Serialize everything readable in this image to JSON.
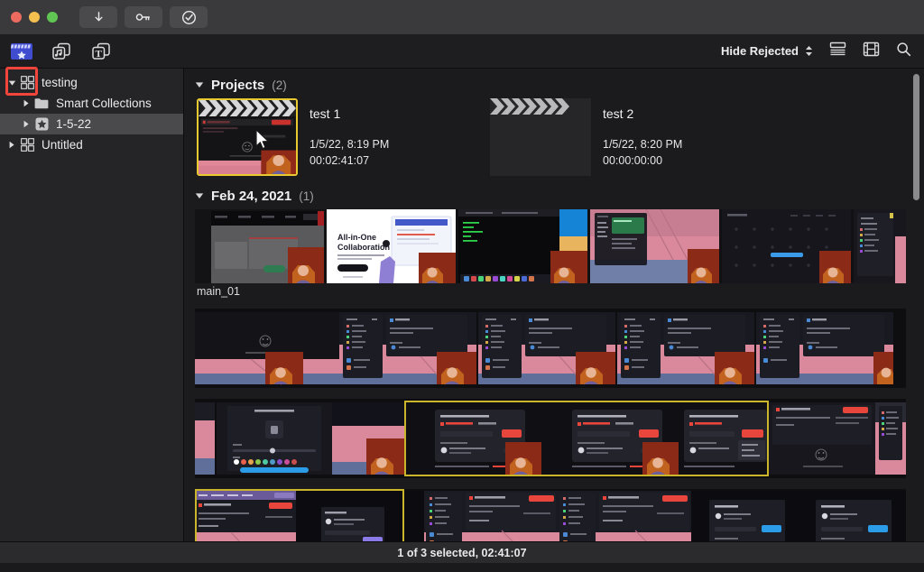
{
  "window": {
    "traffic_lights": [
      "close",
      "minimize",
      "zoom"
    ],
    "toolbar_buttons": [
      {
        "name": "import-media-button",
        "icon": "download-arrow-icon"
      },
      {
        "name": "keyword-editor-button",
        "icon": "key-icon"
      },
      {
        "name": "share-button",
        "icon": "check-circle-icon"
      }
    ]
  },
  "browser_toolbar": {
    "tabs": [
      {
        "name": "photos-and-audio-browser",
        "icon": "clapperboard-icon",
        "active": true
      },
      {
        "name": "music-browser",
        "icon": "music-notes-icon",
        "active": false
      },
      {
        "name": "titles-and-generators-browser",
        "icon": "titles-t-icon",
        "active": false
      }
    ],
    "filter_label": "Hide Rejected",
    "filter_icon": "stepper-chevrons-icon",
    "view_buttons": [
      {
        "name": "list-view-button",
        "icon": "list-view-icon"
      },
      {
        "name": "filmstrip-view-button",
        "icon": "filmstrip-view-icon"
      },
      {
        "name": "search-button",
        "icon": "search-icon"
      }
    ]
  },
  "sidebar": {
    "items": [
      {
        "label": "testing",
        "icon": "library-icon",
        "depth": 0,
        "expanded": true,
        "selected": false,
        "has_disclosure": true
      },
      {
        "label": "Smart Collections",
        "icon": "folder-icon",
        "depth": 1,
        "expanded": false,
        "selected": false,
        "has_disclosure": true
      },
      {
        "label": "1-5-22",
        "icon": "event-star-icon",
        "depth": 1,
        "expanded": false,
        "selected": true,
        "has_disclosure": true
      },
      {
        "label": "Untitled",
        "icon": "library-icon",
        "depth": 0,
        "expanded": false,
        "selected": false,
        "has_disclosure": true
      }
    ]
  },
  "main": {
    "sections": [
      {
        "name": "projects-section",
        "title": "Projects",
        "count": "(2)",
        "collapse_icon": "triangle-down-icon",
        "projects": [
          {
            "name": "test 1",
            "date": "1/5/22, 8:19 PM",
            "duration": "00:02:41:07",
            "selected": true
          },
          {
            "name": "test 2",
            "date": "1/5/22, 8:20 PM",
            "duration": "00:00:00:00",
            "selected": false
          }
        ]
      },
      {
        "name": "date-section",
        "title": "Feb 24, 2021",
        "count": "(1)",
        "collapse_icon": "triangle-down-icon",
        "clip_name": "main_01"
      }
    ]
  },
  "statusbar": {
    "text": "1 of 3 selected, 02:41:07"
  },
  "colors": {
    "selection_yellow": "#e8c92f",
    "annotation_red": "#f4453c",
    "titlebar": "#3a3a3c",
    "sidebar": "#252527",
    "main_bg": "#1b1b1d",
    "active_tab_blue": "#3f4ccf"
  }
}
